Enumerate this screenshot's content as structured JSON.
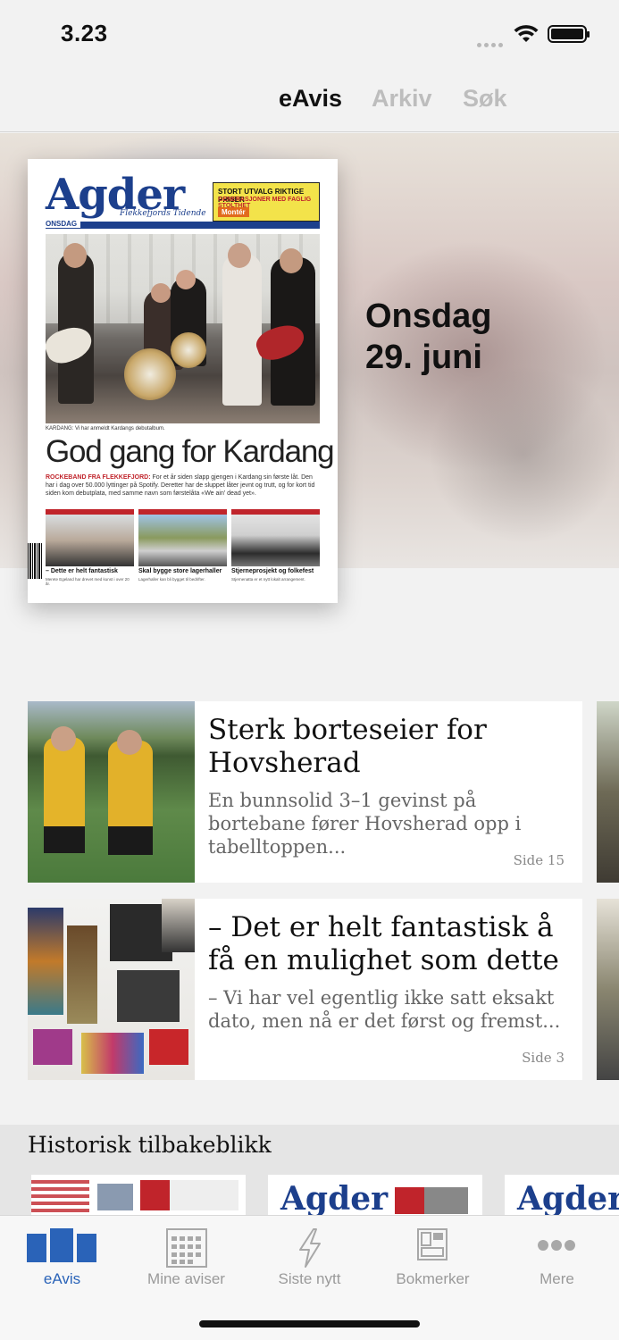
{
  "status_bar": {
    "time": "3.23"
  },
  "top_tabs": [
    {
      "label": "eAvis",
      "active": true
    },
    {
      "label": "Arkiv",
      "active": false
    },
    {
      "label": "Søk",
      "active": false
    }
  ],
  "hero": {
    "weekday": "Onsdag",
    "date": "29. juni",
    "cover": {
      "masthead": "Agder",
      "subtitle": "Flekkefjords Tidende",
      "day_label": "ONSDAG",
      "ad_line1": "STORT UTVALG RIKTIGE PRISER",
      "ad_line2": "GENERASJONER MED FAGLIG STOLTHET",
      "ad_brand": "Montér",
      "photo_caption": "KARDANG: Vi har anmeldt Kardangs debutalbum.",
      "headline": "God gang for Kardang",
      "kicker_label": "ROCKEBAND FRA FLEKKEFJORD:",
      "kicker_text": "For et år siden slapp gjengen i Kardang sin første låt. Den har i dag over 50.000 lyttinger på Spotify. Deretter har de sluppet låter jevnt og trutt, og for kort tid siden kom debutplata, med samme navn som førstelåta «We ain' dead yet».",
      "thumbs": [
        {
          "title": "– Dette er helt fantastisk",
          "snippet": "Merete Egeland har drevet med kunst i over 20 år."
        },
        {
          "title": "Skal bygge store lagerhaller",
          "snippet": "Lagerhaller kan bli bygget til bedrifter."
        },
        {
          "title": "Stjerneprosjekt og folkefest",
          "snippet": "Stjernenatta er et nytt lokalt arrangement."
        }
      ]
    }
  },
  "articles": [
    {
      "title": "Sterk borteseier for Hovsherad",
      "lead": "En bunnsolid 3–1 gevinst på bortebane fører Hovsherad opp i tabelltoppen...",
      "page": "Side 15"
    },
    {
      "title": "– Det er helt fantastisk å få en mulighet som dette",
      "lead": "– Vi har vel egentlig ikke satt eksakt dato, men nå er det først og fremst...",
      "page": "Side 3"
    }
  ],
  "historisk": {
    "title": "Historisk tilbakeblikk",
    "items": [
      {
        "masthead": ""
      },
      {
        "masthead": "Agder"
      },
      {
        "masthead": "Agder"
      }
    ]
  },
  "tab_bar": [
    {
      "label": "eAvis",
      "icon": "eavis-icon",
      "active": true
    },
    {
      "label": "Mine aviser",
      "icon": "grid-icon",
      "active": false
    },
    {
      "label": "Siste nytt",
      "icon": "lightning-icon",
      "active": false
    },
    {
      "label": "Bokmerker",
      "icon": "bookmarks-icon",
      "active": false
    },
    {
      "label": "Mere",
      "icon": "more-icon",
      "active": false
    }
  ],
  "colors": {
    "accent": "#2a63b8",
    "masthead_blue": "#1c3f8c",
    "inactive": "#9a9a9a"
  }
}
